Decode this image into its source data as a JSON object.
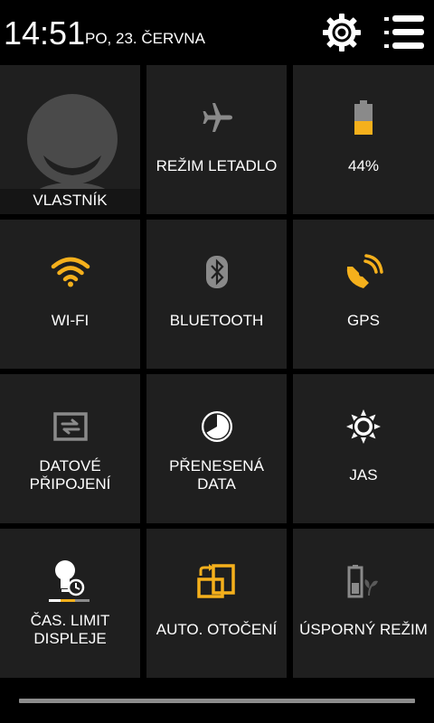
{
  "status": {
    "time": "14:51",
    "date": "PO, 23. ČERVNA"
  },
  "colors": {
    "accent": "#F5B01C",
    "inactive": "#8a8a8a",
    "tile_bg": "#1f1f1f"
  },
  "header": {
    "settings_icon": "gear-icon",
    "menu_icon": "list-menu-icon"
  },
  "tiles": [
    {
      "id": "owner",
      "label": "VLASTNÍK",
      "icon": "avatar-icon",
      "active": false
    },
    {
      "id": "airplane",
      "label": "REŽIM LETADLO",
      "icon": "airplane-icon",
      "active": false
    },
    {
      "id": "battery",
      "label": "44%",
      "icon": "battery-icon",
      "active": true,
      "level": 0.44
    },
    {
      "id": "wifi",
      "label": "WI-FI",
      "icon": "wifi-icon",
      "active": true
    },
    {
      "id": "bluetooth",
      "label": "BLUETOOTH",
      "icon": "bluetooth-icon",
      "active": false
    },
    {
      "id": "gps",
      "label": "GPS",
      "icon": "gps-icon",
      "active": true
    },
    {
      "id": "data",
      "label": "DATOVÉ\nPŘIPOJENÍ",
      "icon": "data-connection-icon",
      "active": false
    },
    {
      "id": "data-usage",
      "label": "PŘENESENÁ\nDATA",
      "icon": "data-usage-icon",
      "active": false
    },
    {
      "id": "brightness",
      "label": "JAS",
      "icon": "brightness-icon",
      "active": false
    },
    {
      "id": "timeout",
      "label": "ČAS. LIMIT\nDISPLEJE",
      "icon": "screen-timeout-icon",
      "active": false
    },
    {
      "id": "rotation",
      "label": "AUTO.  OTOČENÍ",
      "icon": "auto-rotate-icon",
      "active": true
    },
    {
      "id": "power-save",
      "label": "ÚSPORNÝ REŽIM",
      "icon": "power-saving-icon",
      "active": false
    }
  ]
}
